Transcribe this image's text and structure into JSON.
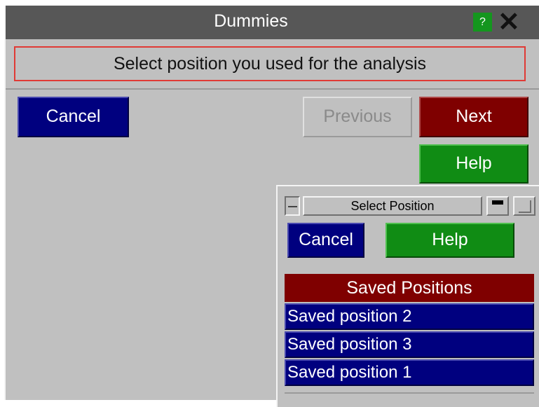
{
  "window": {
    "title": "Dummies",
    "help_icon_glyph": "?",
    "close_icon_glyph": "✕"
  },
  "instruction": "Select position you used for the analysis",
  "buttons": {
    "cancel": "Cancel",
    "previous": "Previous",
    "next": "Next",
    "help": "Help"
  },
  "popup": {
    "title": "Select Position",
    "cancel": "Cancel",
    "help": "Help",
    "list_header": "Saved Positions",
    "items": [
      {
        "label": "Saved position 2"
      },
      {
        "label": "Saved position 3"
      },
      {
        "label": "Saved position 1"
      }
    ]
  },
  "colors": {
    "title_bar": "#575757",
    "blue_button": "#00007f",
    "red_button": "#7f0000",
    "green_button": "#108c14",
    "instruction_border": "#e03a35",
    "panel": "#c0c0c0"
  }
}
